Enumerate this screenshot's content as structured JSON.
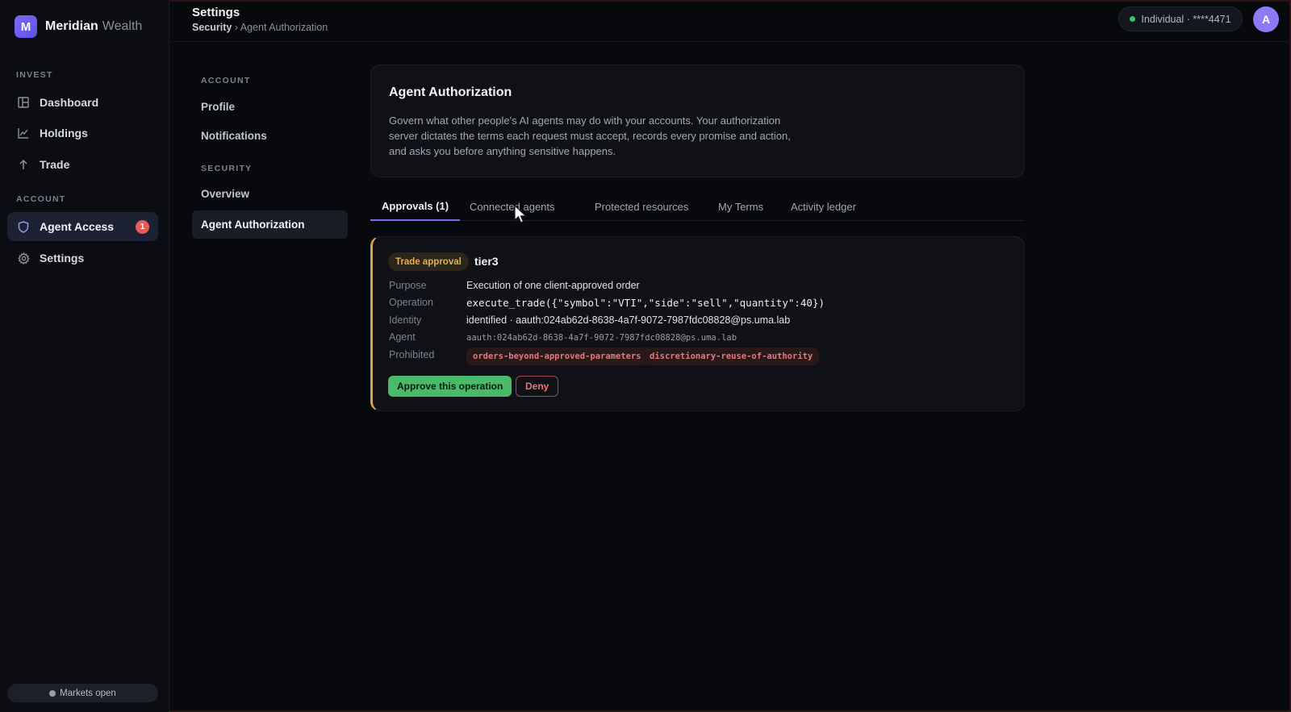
{
  "brand": {
    "logo_letter": "M",
    "name": "Meridian",
    "sub": "Wealth"
  },
  "sidebar": {
    "sections": [
      {
        "label": "INVEST"
      },
      {
        "label": "ACCOUNT"
      }
    ],
    "items": [
      {
        "label": "Dashboard",
        "icon": "dashboard-icon"
      },
      {
        "label": "Holdings",
        "icon": "chart-line-icon"
      },
      {
        "label": "Trade",
        "icon": "arrow-up-icon"
      },
      {
        "label": "Agent Access",
        "icon": "shield-icon",
        "badge": "1",
        "active": true
      },
      {
        "label": "Settings",
        "icon": "gear-icon"
      }
    ],
    "market_status": "Markets open"
  },
  "topbar": {
    "title": "Settings",
    "breadcrumb_root": "Security",
    "breadcrumb_sep": " › ",
    "breadcrumb_current": "Agent Authorization",
    "account": "Individual · ****4471",
    "avatar_letter": "A"
  },
  "subnav": {
    "sections": [
      {
        "label": "ACCOUNT"
      },
      {
        "label": "SECURITY"
      }
    ],
    "items": [
      {
        "label": "Profile"
      },
      {
        "label": "Notifications"
      },
      {
        "label": "Overview"
      },
      {
        "label": "Agent Authorization",
        "active": true
      }
    ]
  },
  "intro": {
    "title": "Agent Authorization",
    "text": "Govern what other people's AI agents may do with your accounts. Your authorization server dictates the terms each request must accept, records every promise and action, and asks you before anything sensitive happens."
  },
  "tabs": [
    {
      "label": "Approvals (1)",
      "active": true
    },
    {
      "label": "Connected agents"
    },
    {
      "label": "Protected resources"
    },
    {
      "label": "My Terms"
    },
    {
      "label": "Activity ledger"
    }
  ],
  "approval": {
    "type_label": "Trade approval",
    "tier": "tier3",
    "labels": {
      "purpose": "Purpose",
      "operation": "Operation",
      "identity": "Identity",
      "agent": "Agent",
      "prohibited": "Prohibited"
    },
    "purpose": "Execution of one client-approved order",
    "operation": "execute_trade({\"symbol\":\"VTI\",\"side\":\"sell\",\"quantity\":40})",
    "identity": "identified · aauth:024ab62d-8638-4a7f-9072-7987fdc08828@ps.uma.lab",
    "agent": "aauth:024ab62d-8638-4a7f-9072-7987fdc08828@ps.uma.lab",
    "prohibited": [
      "orders-beyond-approved-parameters",
      "discretionary-reuse-of-authority"
    ],
    "approve_label": "Approve this operation",
    "deny_label": "Deny"
  },
  "colors": {
    "accent": "#7b6cf6",
    "approve": "#49b96a",
    "deny": "#e2787b",
    "warning": "#d9a548"
  }
}
